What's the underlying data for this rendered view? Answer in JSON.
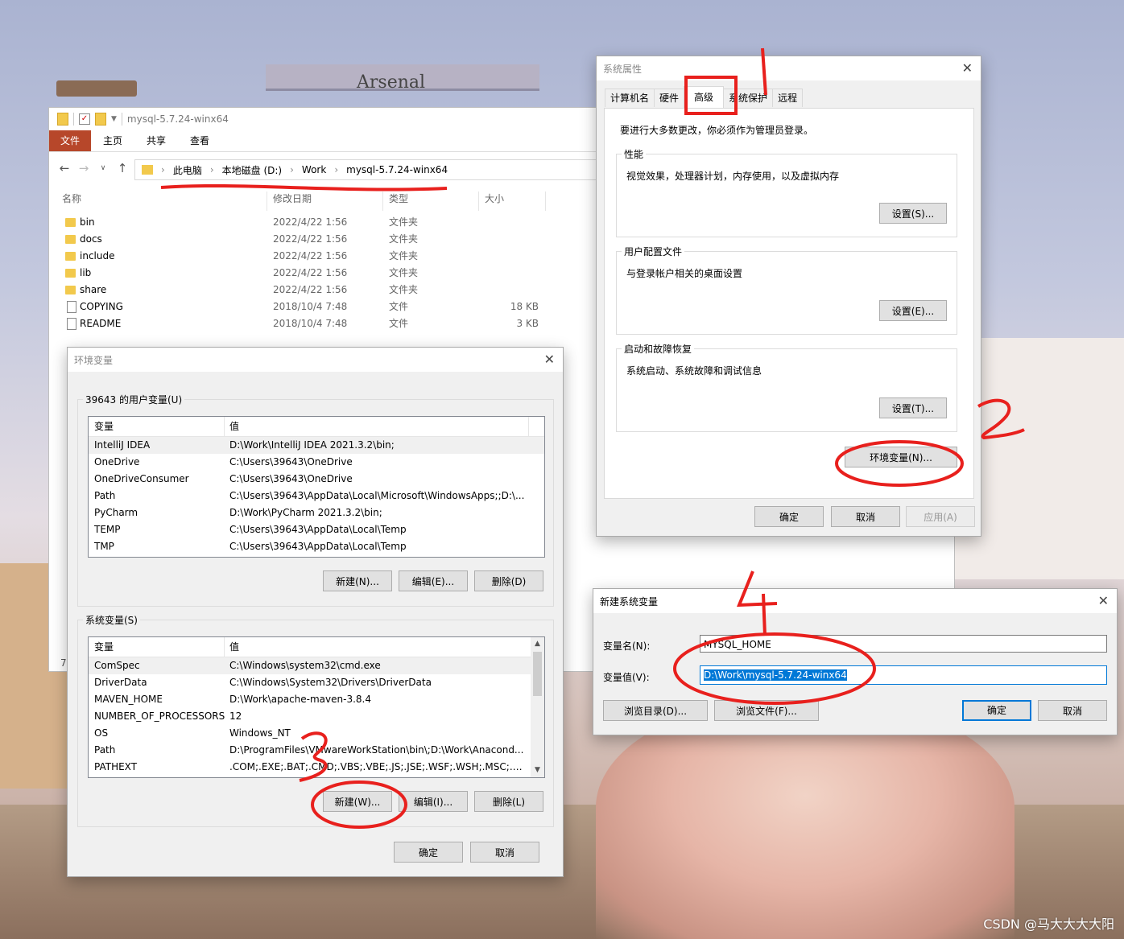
{
  "explorer": {
    "title": "mysql-5.7.24-winx64",
    "ribbon_tabs": [
      "文件",
      "主页",
      "共享",
      "查看"
    ],
    "breadcrumb": [
      "此电脑",
      "本地磁盘 (D:)",
      "Work",
      "mysql-5.7.24-winx64"
    ],
    "columns": [
      "名称",
      "修改日期",
      "类型",
      "大小"
    ],
    "files": [
      {
        "name": "bin",
        "date": "2022/4/22 1:56",
        "type": "文件夹",
        "size": "",
        "kind": "folder"
      },
      {
        "name": "docs",
        "date": "2022/4/22 1:56",
        "type": "文件夹",
        "size": "",
        "kind": "folder"
      },
      {
        "name": "include",
        "date": "2022/4/22 1:56",
        "type": "文件夹",
        "size": "",
        "kind": "folder"
      },
      {
        "name": "lib",
        "date": "2022/4/22 1:56",
        "type": "文件夹",
        "size": "",
        "kind": "folder"
      },
      {
        "name": "share",
        "date": "2022/4/22 1:56",
        "type": "文件夹",
        "size": "",
        "kind": "folder"
      },
      {
        "name": "COPYING",
        "date": "2018/10/4 7:48",
        "type": "文件",
        "size": "18 KB",
        "kind": "file"
      },
      {
        "name": "README",
        "date": "2018/10/4 7:48",
        "type": "文件",
        "size": "3 KB",
        "kind": "file"
      }
    ],
    "item_count": "7"
  },
  "sysprops": {
    "title": "系统属性",
    "tabs": [
      "计算机名",
      "硬件",
      "高级",
      "系统保护",
      "远程"
    ],
    "admin_note": "要进行大多数更改，你必须作为管理员登录。",
    "groups": [
      {
        "label": "性能",
        "desc": "视觉效果，处理器计划，内存使用，以及虚拟内存",
        "button": "设置(S)..."
      },
      {
        "label": "用户配置文件",
        "desc": "与登录帐户相关的桌面设置",
        "button": "设置(E)..."
      },
      {
        "label": "启动和故障恢复",
        "desc": "系统启动、系统故障和调试信息",
        "button": "设置(T)..."
      }
    ],
    "env_button": "环境变量(N)...",
    "ok": "确定",
    "cancel": "取消",
    "apply": "应用(A)"
  },
  "envvars": {
    "title": "环境变量",
    "user_group_label": "39643 的用户变量(U)",
    "sys_group_label": "系统变量(S)",
    "col_var": "变量",
    "col_val": "值",
    "user_vars": [
      {
        "name": "IntelliJ IDEA",
        "value": "D:\\Work\\IntelliJ IDEA 2021.3.2\\bin;"
      },
      {
        "name": "OneDrive",
        "value": "C:\\Users\\39643\\OneDrive"
      },
      {
        "name": "OneDriveConsumer",
        "value": "C:\\Users\\39643\\OneDrive"
      },
      {
        "name": "Path",
        "value": "C:\\Users\\39643\\AppData\\Local\\Microsoft\\WindowsApps;;D:\\..."
      },
      {
        "name": "PyCharm",
        "value": "D:\\Work\\PyCharm 2021.3.2\\bin;"
      },
      {
        "name": "TEMP",
        "value": "C:\\Users\\39643\\AppData\\Local\\Temp"
      },
      {
        "name": "TMP",
        "value": "C:\\Users\\39643\\AppData\\Local\\Temp"
      }
    ],
    "sys_vars": [
      {
        "name": "ComSpec",
        "value": "C:\\Windows\\system32\\cmd.exe"
      },
      {
        "name": "DriverData",
        "value": "C:\\Windows\\System32\\Drivers\\DriverData"
      },
      {
        "name": "MAVEN_HOME",
        "value": "D:\\Work\\apache-maven-3.8.4"
      },
      {
        "name": "NUMBER_OF_PROCESSORS",
        "value": "12"
      },
      {
        "name": "OS",
        "value": "Windows_NT"
      },
      {
        "name": "Path",
        "value": "D:\\ProgramFiles\\VMwareWorkStation\\bin\\;D:\\Work\\Anacond..."
      },
      {
        "name": "PATHEXT",
        "value": ".COM;.EXE;.BAT;.CMD;.VBS;.VBE;.JS;.JSE;.WSF;.WSH;.MSC;.PY;.P..."
      }
    ],
    "user_new": "新建(N)...",
    "user_edit": "编辑(E)...",
    "user_delete": "删除(D)",
    "sys_new": "新建(W)...",
    "sys_edit": "编辑(I)...",
    "sys_delete": "删除(L)",
    "ok": "确定",
    "cancel": "取消"
  },
  "newvar": {
    "title": "新建系统变量",
    "name_label": "变量名(N):",
    "value_label": "变量值(V):",
    "name_value": "MYSQL_HOME",
    "value_value": "D:\\Work\\mysql-5.7.24-winx64",
    "browse_dir": "浏览目录(D)...",
    "browse_file": "浏览文件(F)...",
    "ok": "确定",
    "cancel": "取消"
  },
  "annotations": {
    "step1": "1",
    "step2": "2",
    "step3": "3",
    "step4": "4",
    "color": "#e8201d"
  },
  "watermark": "CSDN @马大大大大阳",
  "wallpaper_text": "Arsenal"
}
